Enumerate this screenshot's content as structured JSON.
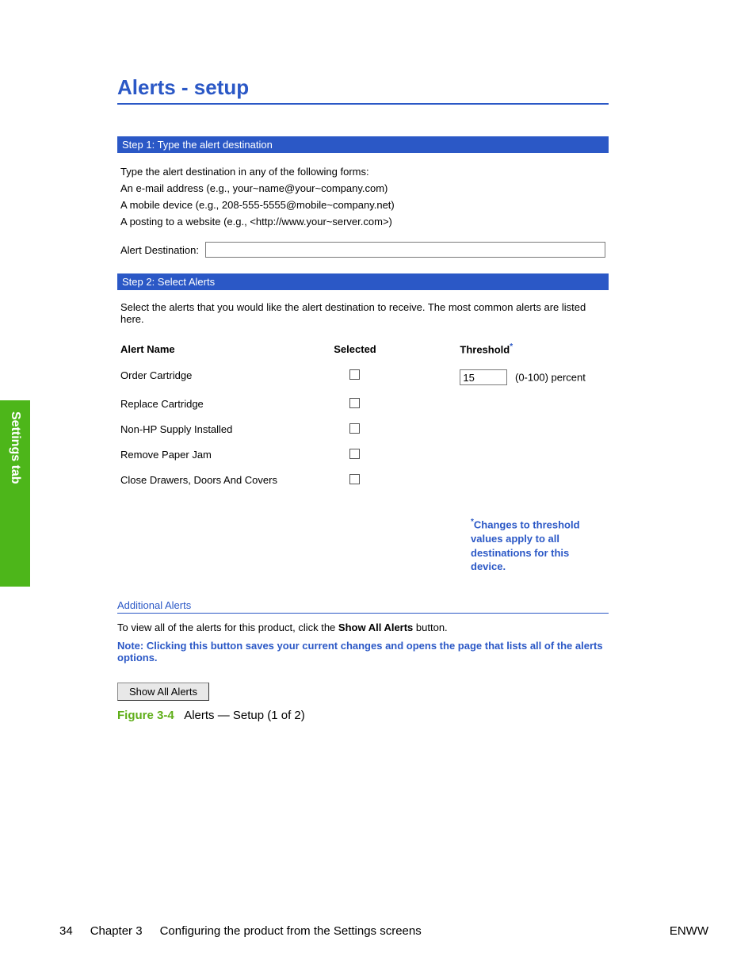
{
  "sideTab": "Settings tab",
  "title": "Alerts - setup",
  "step1": {
    "header": "Step 1: Type the alert destination",
    "intro": "Type the alert destination in any of the following forms:",
    "examples": [
      "An e-mail address (e.g., your~name@your~company.com)",
      "A mobile device (e.g., 208-555-5555@mobile~company.net)",
      "A posting to a website (e.g., <http://www.your~server.com>)"
    ],
    "destLabel": "Alert Destination:",
    "destValue": ""
  },
  "step2": {
    "header": "Step 2: Select Alerts",
    "intro": "Select the alerts that you would like the alert destination to receive. The most common alerts are listed here.",
    "columns": {
      "alert": "Alert Name",
      "selected": "Selected",
      "threshold": "Threshold"
    },
    "rows": [
      {
        "name": "Order Cartridge",
        "selected": false,
        "threshold": "15",
        "suffix": "(0-100) percent"
      },
      {
        "name": "Replace Cartridge",
        "selected": false
      },
      {
        "name": "Non-HP Supply Installed",
        "selected": false
      },
      {
        "name": "Remove Paper Jam",
        "selected": false
      },
      {
        "name": "Close Drawers, Doors And Covers",
        "selected": false
      }
    ],
    "thresholdNote": "Changes to threshold values apply to all destinations for this device."
  },
  "additional": {
    "header": "Additional Alerts",
    "line1a": "To view all of the alerts for this product, click the ",
    "line1b": "Show All Alerts",
    "line1c": " button.",
    "note": "Note: Clicking this button saves your current changes and opens the page that lists all of the alerts options.",
    "button": "Show All Alerts"
  },
  "figure": {
    "label": "Figure 3-4",
    "text": "Alerts — Setup (1 of 2)"
  },
  "footer": {
    "pageNum": "34",
    "chapter": "Chapter 3",
    "chapterTitle": "Configuring the product from the Settings screens",
    "right": "ENWW"
  }
}
